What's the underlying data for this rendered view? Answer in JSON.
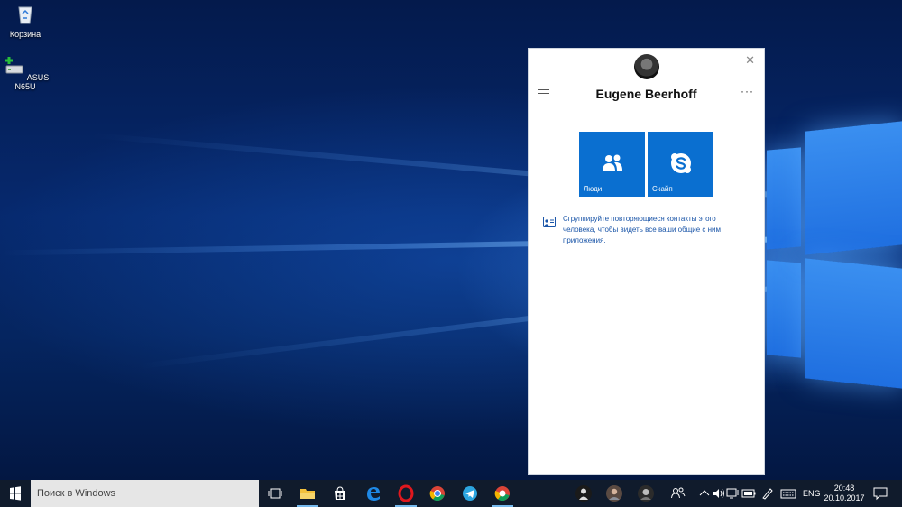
{
  "desktop": {
    "icons": [
      {
        "label": "Корзина",
        "icon": "recycle-bin-icon"
      },
      {
        "label": "ASUS N65U",
        "icon": "network-drive-icon"
      }
    ]
  },
  "people_flyout": {
    "contact_name": "Eugene Beerhoff",
    "close_glyph": "✕",
    "more_glyph": "···",
    "tiles": [
      {
        "label": "Люди",
        "icon": "people-icon",
        "color": "#0a6fd0"
      },
      {
        "label": "Скайп",
        "icon": "skype-icon",
        "color": "#0a6fd0"
      }
    ],
    "tip_text": "Сгруппируйте повторяющиеся контакты этого человека, чтобы видеть все ваши общие с ним приложения."
  },
  "taskbar": {
    "search_placeholder": "Поиск в Windows",
    "pinned": [
      "task-view-icon",
      "file-explorer-icon",
      "store-icon",
      "edge-icon",
      "opera-icon",
      "chrome-icon",
      "telegram-icon",
      "chrome-canary-icon"
    ],
    "people": [
      "contact-1-avatar",
      "contact-2-avatar",
      "contact-3-avatar",
      "people-button-icon"
    ],
    "tray": {
      "language": "ENG",
      "time": "20:48",
      "date": "20.10.2017"
    },
    "accent": "#76b9ed"
  }
}
